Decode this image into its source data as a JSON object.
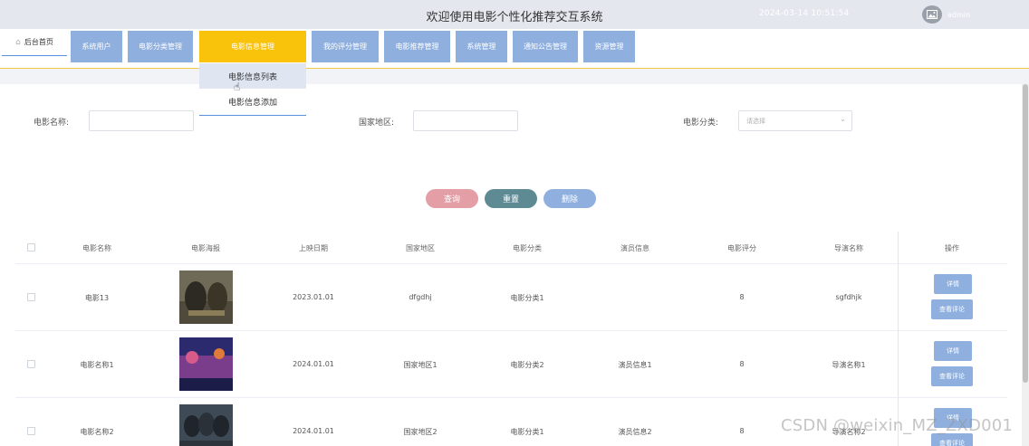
{
  "header": {
    "title": "欢迎使用电影个性化推荐交互系统",
    "datetime": "2024-03-14 10:51:54",
    "user": "admin"
  },
  "nav": {
    "home": "后台首页",
    "items": [
      "系统用户",
      "电影分类管理",
      "电影信息管理",
      "我的评分管理",
      "电影推荐管理",
      "系统管理",
      "通知公告管理",
      "资源管理"
    ],
    "active_index": 2,
    "dropdown": [
      "电影信息列表",
      "电影信息添加"
    ]
  },
  "filters": {
    "name_label": "电影名称:",
    "country_label": "国家地区:",
    "category_label": "电影分类:",
    "category_placeholder": "请选择"
  },
  "buttons": {
    "search": "查询",
    "reset": "重置",
    "delete": "删除"
  },
  "table": {
    "columns": [
      "电影名称",
      "电影海报",
      "上映日期",
      "国家地区",
      "电影分类",
      "演员信息",
      "电影评分",
      "导演名称",
      "操作"
    ],
    "rows": [
      {
        "name": "电影13",
        "date": "2023.01.01",
        "country": "dfgdhj",
        "category": "电影分类1",
        "actors": "",
        "score": "8",
        "director": "sgfdhjk"
      },
      {
        "name": "电影名称1",
        "date": "2024.01.01",
        "country": "国家地区1",
        "category": "电影分类2",
        "actors": "演员信息1",
        "score": "8",
        "director": "导演名称1"
      },
      {
        "name": "电影名称2",
        "date": "2024.01.01",
        "country": "国家地区2",
        "category": "电影分类1",
        "actors": "演员信息2",
        "score": "8",
        "director": "导演名称2"
      }
    ],
    "detail_label": "详情",
    "comments_label": "查看评论"
  },
  "watermark": "CSDN @weixin_MZ_ZXD001",
  "colors": {
    "nav_button": "#8fb0df",
    "nav_active": "#f9c20b",
    "search_button": "#e39ea6",
    "reset_button": "#5e8a94",
    "delete_button": "#8fb0df"
  }
}
